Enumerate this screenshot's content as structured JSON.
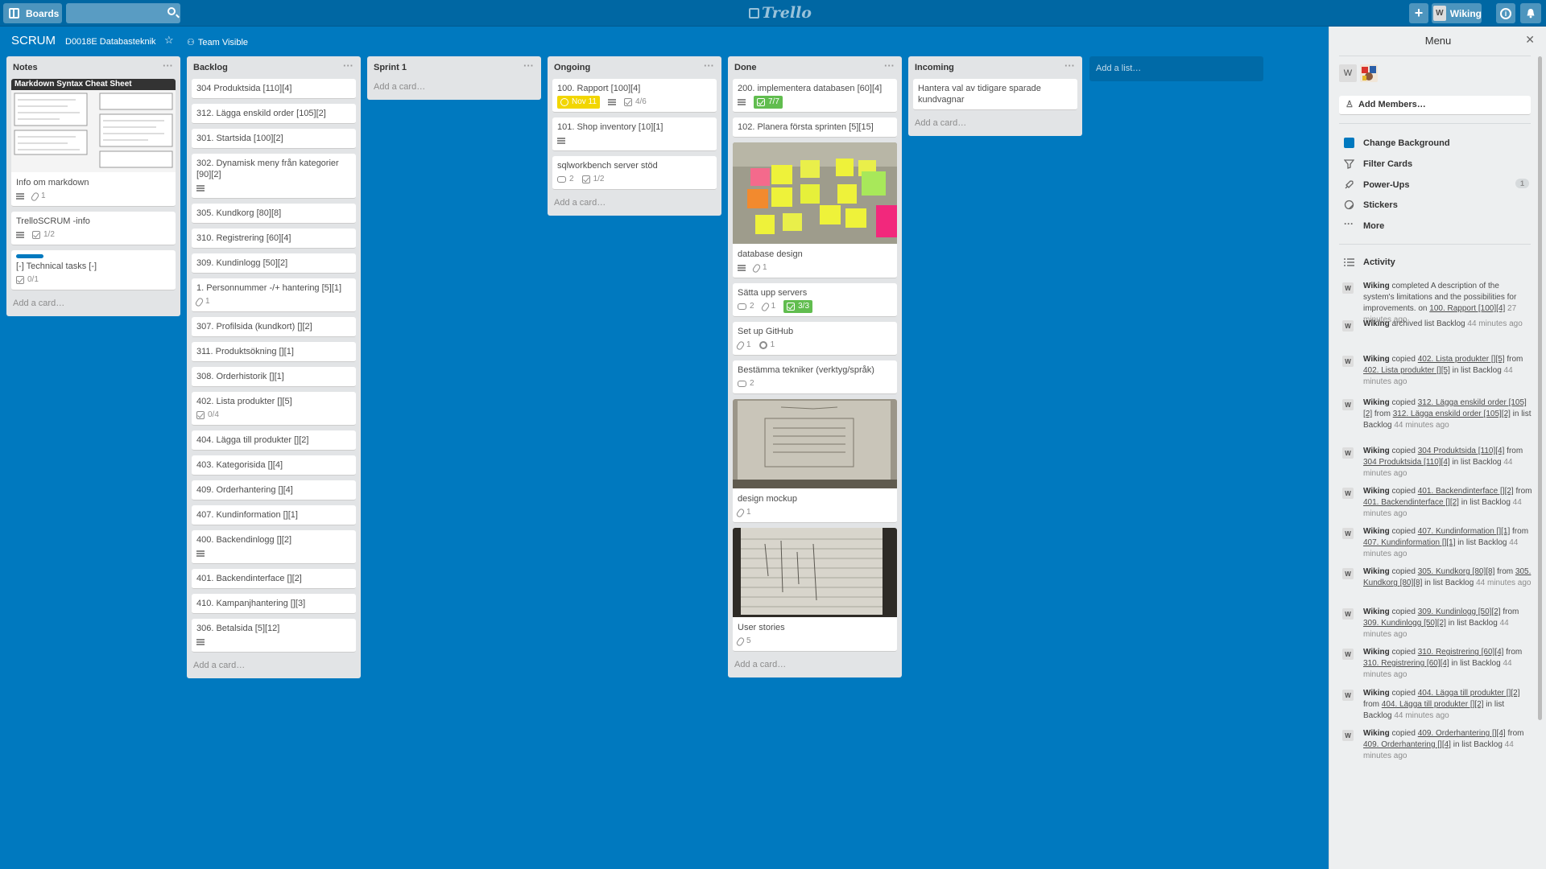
{
  "header": {
    "boards_label": "Boards",
    "search_placeholder": "",
    "logo_text": "Trello",
    "plus_label": "+",
    "user_initial": "W",
    "user_name": "Wiking",
    "info_label": "i"
  },
  "board": {
    "title": "SCRUM",
    "org": "D0018E Databasteknik",
    "star": "☆",
    "visibility": "Team Visible"
  },
  "add_card_label": "Add a card…",
  "add_list_label": "Add a list…",
  "lists": {
    "notes": {
      "name": "Notes",
      "cover_title": "Markdown Syntax Cheat Sheet",
      "cards": [
        {
          "title": "Info om markdown",
          "attachments": "1"
        },
        {
          "title": "TrelloSCRUM -info",
          "checklist": "1/2"
        },
        {
          "title": "[-] Technical tasks [-]",
          "checklist": "0/1"
        }
      ]
    },
    "backlog": {
      "name": "Backlog",
      "cards": [
        {
          "title": "304 Produktsida [110][4]"
        },
        {
          "title": "312. Lägga enskild order [105][2]"
        },
        {
          "title": "301. Startsida [100][2]"
        },
        {
          "title": "302. Dynamisk meny från kategorier [90][2]"
        },
        {
          "title": "305. Kundkorg [80][8]"
        },
        {
          "title": "310. Registrering [60][4]"
        },
        {
          "title": "309. Kundinlogg [50][2]"
        },
        {
          "title": "1. Personnummer -/+ hantering [5][1]",
          "attachments": "1"
        },
        {
          "title": "307. Profilsida (kundkort) [][2]"
        },
        {
          "title": "311. Produktsökning [][1]"
        },
        {
          "title": "308. Orderhistorik [][1]"
        },
        {
          "title": "402. Lista produkter [][5]",
          "checklist": "0/4"
        },
        {
          "title": "404. Lägga till produkter [][2]"
        },
        {
          "title": "403. Kategorisida [][4]"
        },
        {
          "title": "409. Orderhantering [][4]"
        },
        {
          "title": "407. Kundinformation [][1]"
        },
        {
          "title": "400. Backendinlogg [][2]"
        },
        {
          "title": "401. Backendinterface [][2]"
        },
        {
          "title": "410. Kampanjhantering [][3]"
        },
        {
          "title": "306. Betalsida [5][12]"
        }
      ]
    },
    "sprint1": {
      "name": "Sprint 1"
    },
    "ongoing": {
      "name": "Ongoing",
      "cards": [
        {
          "title": "100. Rapport [100][4]",
          "due": "Nov 11",
          "checklist": "4/6"
        },
        {
          "title": "101. Shop inventory [10][1]"
        },
        {
          "title": "sqlworkbench server stöd",
          "comments": "2",
          "checklist": "1/2"
        }
      ]
    },
    "done": {
      "name": "Done",
      "cards": [
        {
          "title": "200. implementera databasen [60][4]",
          "checklist": "7/7"
        },
        {
          "title": "102. Planera första sprinten [5][15]"
        },
        {
          "title": "database design",
          "attachments": "1"
        },
        {
          "title": "Sätta upp servers",
          "comments": "2",
          "attachments": "1",
          "checklist": "3/3"
        },
        {
          "title": "Set up GitHub",
          "attachments": "1",
          "github": "1"
        },
        {
          "title": "Bestämma tekniker (verktyg/språk)",
          "comments": "2"
        },
        {
          "title": "design mockup",
          "attachments": "1"
        },
        {
          "title": "User stories",
          "attachments": "5"
        }
      ]
    },
    "incoming": {
      "name": "Incoming",
      "cards": [
        {
          "title": "Hantera val av tidigare sparade kundvagnar"
        }
      ]
    }
  },
  "sidebar": {
    "title": "Menu",
    "close": "✕",
    "add_members": "Add Members…",
    "items": {
      "change_background": "Change Background",
      "filter_cards": "Filter Cards",
      "power_ups": "Power-Ups",
      "power_ups_count": "1",
      "stickers": "Stickers",
      "more": "More"
    },
    "activity_title": "Activity",
    "activity": [
      {
        "user": "Wiking",
        "pre": " completed A description of the system's limitations and the possibilities for improvements. on ",
        "link1": "100. Rapport [100][4]",
        "mid": "",
        "link2": "",
        "post": "",
        "time": "27 minutes ago"
      },
      {
        "user": "Wiking",
        "pre": " archived list Backlog",
        "link1": "",
        "mid": "",
        "link2": "",
        "post": "",
        "time": "44 minutes ago"
      },
      {
        "user": "Wiking",
        "pre": " copied ",
        "link1": "402. Lista produkter [][5]",
        "mid": " from ",
        "link2": "402. Lista produkter [][5]",
        "post": " in list Backlog",
        "time": "44 minutes ago"
      },
      {
        "user": "Wiking",
        "pre": " copied ",
        "link1": "312. Lägga enskild order [105][2]",
        "mid": " from ",
        "link2": "312. Lägga enskild order [105][2]",
        "post": " in list Backlog",
        "time": "44 minutes ago"
      },
      {
        "user": "Wiking",
        "pre": " copied ",
        "link1": "304 Produktsida [110][4]",
        "mid": " from ",
        "link2": "304 Produktsida [110][4]",
        "post": " in list Backlog",
        "time": "44 minutes ago"
      },
      {
        "user": "Wiking",
        "pre": " copied ",
        "link1": "401. Backendinterface [][2]",
        "mid": " from ",
        "link2": "401. Backendinterface [][2]",
        "post": " in list Backlog",
        "time": "44 minutes ago"
      },
      {
        "user": "Wiking",
        "pre": " copied ",
        "link1": "407. Kundinformation [][1]",
        "mid": " from ",
        "link2": "407. Kundinformation [][1]",
        "post": " in list Backlog",
        "time": "44 minutes ago"
      },
      {
        "user": "Wiking",
        "pre": " copied ",
        "link1": "305. Kundkorg [80][8]",
        "mid": " from ",
        "link2": "305. Kundkorg [80][8]",
        "post": " in list Backlog",
        "time": "44 minutes ago"
      },
      {
        "user": "Wiking",
        "pre": " copied ",
        "link1": "309. Kundinlogg [50][2]",
        "mid": " from ",
        "link2": "309. Kundinlogg [50][2]",
        "post": " in list Backlog",
        "time": "44 minutes ago"
      },
      {
        "user": "Wiking",
        "pre": " copied ",
        "link1": "310. Registrering [60][4]",
        "mid": " from ",
        "link2": "310. Registrering [60][4]",
        "post": " in list Backlog",
        "time": "44 minutes ago"
      },
      {
        "user": "Wiking",
        "pre": " copied ",
        "link1": "404. Lägga till produkter [][2]",
        "mid": " from ",
        "link2": "404. Lägga till produkter [][2]",
        "post": " in list Backlog",
        "time": "44 minutes ago"
      },
      {
        "user": "Wiking",
        "pre": " copied ",
        "link1": "409. Orderhantering [][4]",
        "mid": " from ",
        "link2": "409. Orderhantering [][4]",
        "post": " in list Backlog",
        "time": "44 minutes ago"
      }
    ]
  },
  "colors": {
    "board_bg": "#0079bf",
    "header_bg": "#0067a3",
    "label_blue": "#0079bf",
    "badge_green": "#61bd4f",
    "badge_yellow": "#f2d600"
  }
}
